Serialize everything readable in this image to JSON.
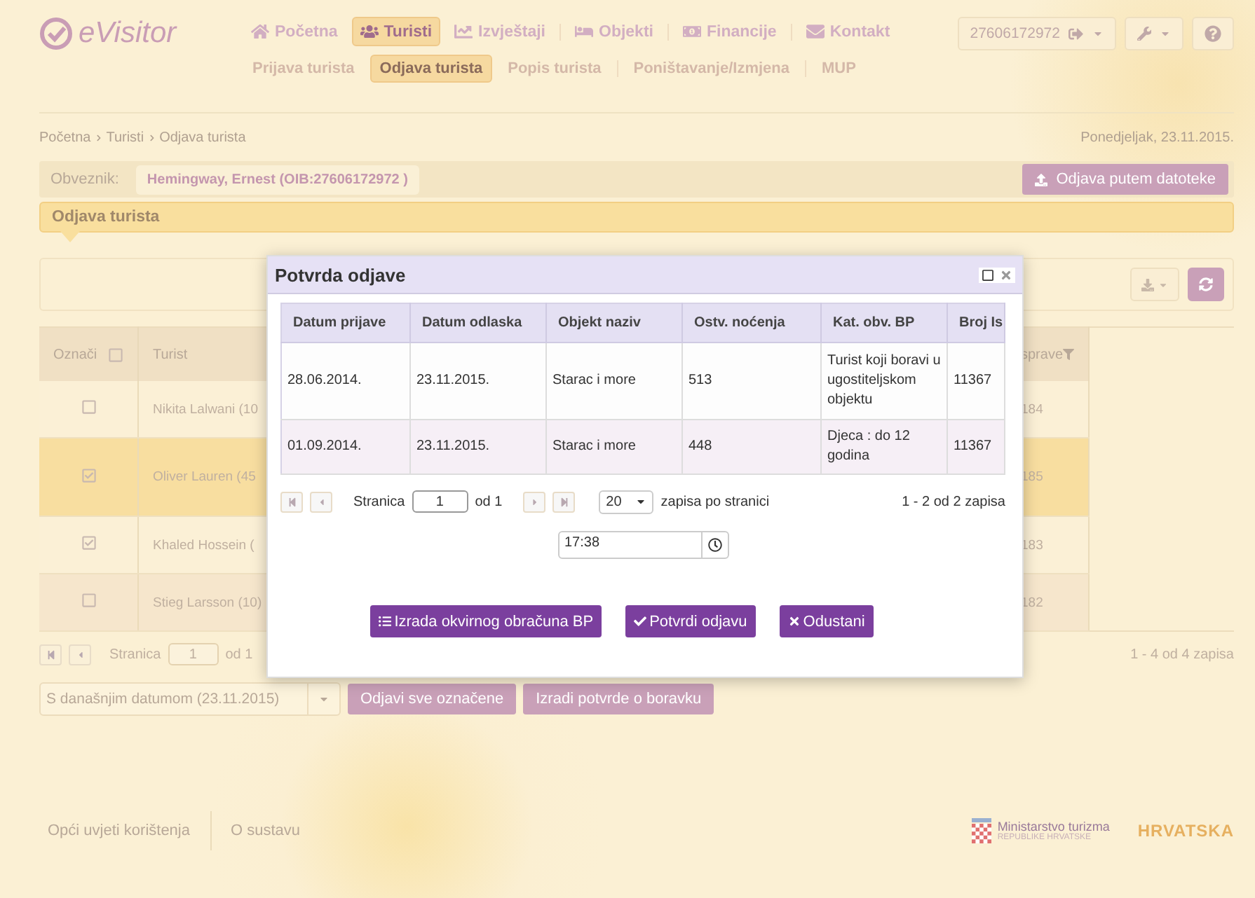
{
  "header": {
    "logo": "eVisitor",
    "nav": [
      {
        "label": "Početna",
        "selected": false
      },
      {
        "label": "Turisti",
        "selected": true
      },
      {
        "label": "Izvještaji",
        "selected": false
      },
      {
        "label": "Objekti",
        "selected": false
      },
      {
        "label": "Financije",
        "selected": false
      },
      {
        "label": "Kontakt",
        "selected": false
      }
    ],
    "subnav": [
      {
        "label": "Prijava turista",
        "selected": false
      },
      {
        "label": "Odjava turista",
        "selected": true
      },
      {
        "label": "Popis turista",
        "selected": false
      },
      {
        "label": "Poništavanje/Izmjena",
        "selected": false
      },
      {
        "label": "MUP",
        "selected": false
      }
    ],
    "account": "27606172972"
  },
  "breadcrumb": [
    "Početna",
    "Turisti",
    "Odjava turista"
  ],
  "date": "Ponedjeljak, 23.11.2015.",
  "obveznik": {
    "label": "Obveznik:",
    "value": "Hemingway, Ernest (OIB:27606172972 )"
  },
  "file_button": "Odjava putem datoteke",
  "section_title": "Odjava turista",
  "table": {
    "columns": [
      "Označi",
      "Turist",
      "sprave"
    ],
    "header_checked": false,
    "rows": [
      {
        "checked": false,
        "selected": false,
        "turist": "Nikita Lalwani (10",
        "col3": "184"
      },
      {
        "checked": true,
        "selected": true,
        "turist": "Oliver Lauren (45",
        "col3": "185"
      },
      {
        "checked": true,
        "selected": false,
        "turist": "Khaled Hossein (",
        "col3": "183"
      },
      {
        "checked": false,
        "selected": false,
        "turist": "Stieg Larsson (10)",
        "col3": "182"
      }
    ]
  },
  "pager": {
    "label": "Stranica",
    "page": "1",
    "of": "od 1",
    "summary": "1 - 4 od 4 zapisa"
  },
  "date_select": "S današnjim datumom (23.11.2015)",
  "actions": [
    "Odjavi sve označene",
    "Izradi potvrde o boravku"
  ],
  "modal": {
    "title": "Potvrda odjave",
    "columns": [
      "Datum prijave",
      "Datum odlaska",
      "Objekt naziv",
      "Ostv. noćenja",
      "Kat. obv. BP",
      "Broj Is"
    ],
    "rows": [
      [
        "28.06.2014.",
        "23.11.2015.",
        "Starac i more",
        "513",
        "Turist koji boravi u ugostiteljskom objektu",
        "11367"
      ],
      [
        "01.09.2014.",
        "23.11.2015.",
        "Starac i more",
        "448",
        "Djeca : do 12 godina",
        "11367"
      ]
    ],
    "pager": {
      "label": "Stranica",
      "page": "1",
      "of": "od 1",
      "page_size": "20",
      "per_page": "zapisa po stranici",
      "summary": "1 - 2 od 2 zapisa"
    },
    "time": "17:38",
    "buttons": [
      "Izrada okvirnog obračuna BP",
      "Potvrdi odjavu",
      "Odustani"
    ]
  },
  "footer": {
    "links": [
      "Opći uvjeti korištenja",
      "O sustavu"
    ],
    "ministry": "Ministarstvo turizma",
    "ministry_sub": "REPUBLIKE HRVATSKE",
    "logo": "HRVATSKA"
  }
}
